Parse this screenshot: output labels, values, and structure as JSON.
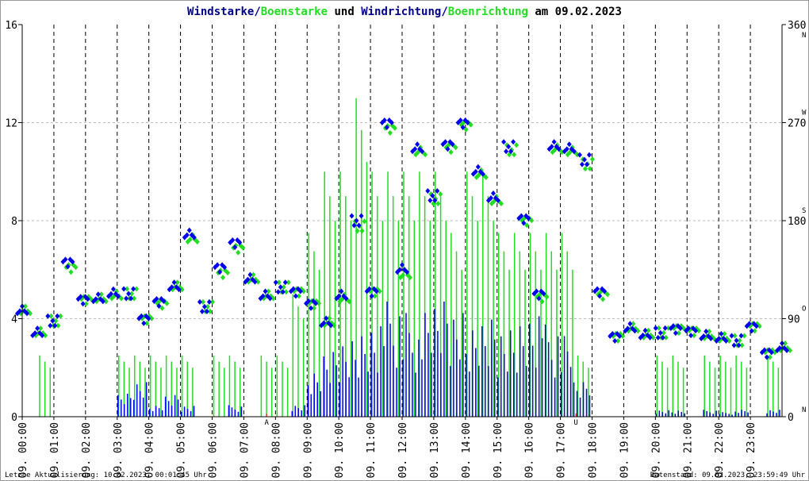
{
  "chart_data": {
    "type": "bar",
    "title_parts": [
      {
        "text": "Windstarke",
        "color": "#00008b"
      },
      {
        "text": "/",
        "color": "#00008b"
      },
      {
        "text": "Boenstarke",
        "color": "#22dd22"
      },
      {
        "text": " und ",
        "color": "#000000"
      },
      {
        "text": "Windrichtung",
        "color": "#00008b"
      },
      {
        "text": "/",
        "color": "#00008b"
      },
      {
        "text": "Boenrichtung",
        "color": "#22dd22"
      },
      {
        "text": " am 09.02.2023",
        "color": "#000000"
      }
    ],
    "x_unit": "hours (half-hour samples)",
    "x_tick_labels": [
      "09. 00:00",
      "09. 01:00",
      "09. 02:00",
      "09. 03:00",
      "09. 04:00",
      "09. 05:00",
      "09. 06:00",
      "09. 07:00",
      "09. 08:00",
      "09. 09:00",
      "09. 10:00",
      "09. 11:00",
      "09. 12:00",
      "09. 13:00",
      "09. 14:00",
      "09. 15:00",
      "09. 16:00",
      "09. 17:00",
      "09. 18:00",
      "09. 19:00",
      "09. 20:00",
      "09. 21:00",
      "09. 22:00",
      "09. 23:00"
    ],
    "ylim_left": [
      0,
      16
    ],
    "yticks_left": [
      0,
      4,
      8,
      12,
      16
    ],
    "ylim_right": [
      0,
      360
    ],
    "yticks_right": [
      0,
      90,
      180,
      270,
      360
    ],
    "compass_labels": [
      "N",
      "O",
      "S",
      "W",
      "N"
    ],
    "series": [
      {
        "name": "Windstarke",
        "color": "#0000ee",
        "values": [
          0,
          0,
          0,
          0,
          0,
          0,
          1,
          1.5,
          0.5,
          1,
          0.5,
          0,
          0,
          0.5,
          0,
          0,
          0,
          0.5,
          2,
          3,
          3.5,
          4,
          4.5,
          5,
          4.5,
          4.5,
          5,
          4.5,
          4,
          4.5,
          4,
          4.5,
          5,
          4,
          3.5,
          1.5,
          0,
          0,
          0,
          0,
          0.3,
          0.3,
          0,
          0.3,
          0.2,
          0.3,
          0,
          0.3
        ]
      },
      {
        "name": "Boenstarke",
        "color": "#22dd22",
        "values": [
          0,
          2.5,
          0,
          0,
          0,
          0,
          2.5,
          2.5,
          2.5,
          2.5,
          2.5,
          0,
          2.5,
          2.5,
          0,
          2.5,
          2.5,
          5,
          7.5,
          10,
          10,
          13,
          10,
          10,
          10,
          10,
          10,
          7.5,
          10,
          10,
          7.5,
          7.5,
          7.5,
          7.5,
          7.5,
          2.5,
          0,
          0,
          0,
          0,
          2.5,
          2.5,
          0,
          2.5,
          2.5,
          2.5,
          0,
          2.5
        ]
      },
      {
        "name": "Windrichtung",
        "color": "#0000ee",
        "values": [
          97,
          79,
          88,
          140,
          108,
          108,
          115,
          113,
          88,
          106,
          119,
          169,
          101,
          135,
          160,
          126,
          113,
          119,
          113,
          104,
          86,
          113,
          180,
          113,
          270,
          135,
          248,
          203,
          248,
          270,
          225,
          203,
          248,
          180,
          113,
          248,
          248,
          236,
          113,
          74,
          81,
          77,
          77,
          79,
          79,
          74,
          74,
          70,
          81,
          59,
          63
        ]
      },
      {
        "name": "Boenrichtung",
        "color": "#22dd22",
        "values": [
          97,
          79,
          88,
          135,
          108,
          108,
          113,
          113,
          88,
          104,
          119,
          165,
          101,
          130,
          155,
          126,
          113,
          119,
          113,
          104,
          86,
          110,
          175,
          113,
          265,
          130,
          245,
          200,
          245,
          268,
          222,
          200,
          245,
          178,
          110,
          245,
          245,
          232,
          110,
          74,
          81,
          77,
          77,
          79,
          79,
          74,
          74,
          70,
          81,
          59,
          63
        ]
      }
    ],
    "annotations": [
      {
        "text": "A",
        "hour": 7.72,
        "color": "#ff0000"
      },
      {
        "text": "U",
        "hour": 17.49,
        "color": "#ff0000"
      }
    ]
  },
  "footer": {
    "left": "Letzte Aktualisierung: 10.02.2023, 00:01:45 Uhr",
    "right": "Datenstand: 09.02.2023, 23:59:49 Uhr"
  }
}
